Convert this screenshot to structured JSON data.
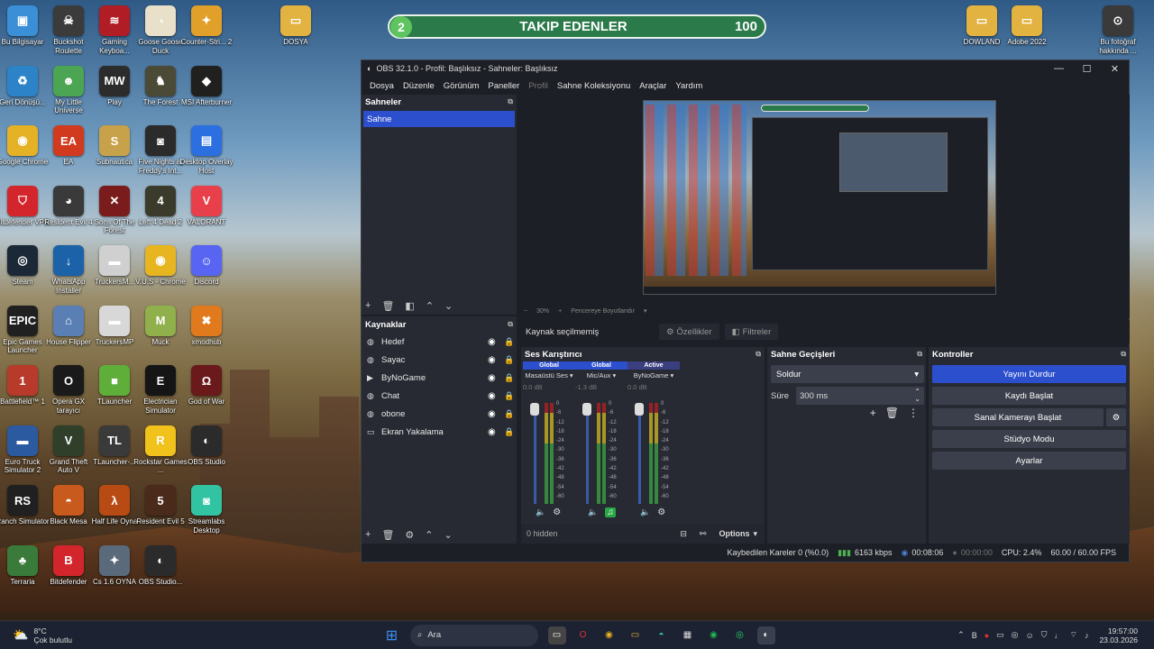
{
  "follow_bar": {
    "level": "2",
    "title": "TAKIP EDENLER",
    "count": "100"
  },
  "desktop_icons_left": [
    {
      "label": "Bu Bilgisayar",
      "color": "#3a8fd6",
      "glyph": "▣"
    },
    {
      "label": "Buckshot Roulette",
      "color": "#3b3b3b",
      "glyph": "☠"
    },
    {
      "label": "Gaming Keyboa...",
      "color": "#b01d24",
      "glyph": "≋"
    },
    {
      "label": "Goose Goose Duck",
      "color": "#e8e0c8",
      "glyph": "◔"
    },
    {
      "label": "Counter-Stri... 2",
      "color": "#e1a02a",
      "glyph": "✦"
    },
    {
      "label": "Geri Dönüşü...",
      "color": "#2d83c7",
      "glyph": "♻"
    },
    {
      "label": "My Little Universe",
      "color": "#4ca552",
      "glyph": "☻"
    },
    {
      "label": "Play",
      "color": "#2c2c2c",
      "glyph": "MW"
    },
    {
      "label": "The Forest",
      "color": "#4a4a36",
      "glyph": "♞"
    },
    {
      "label": "MSI Afterburner",
      "color": "#20201f",
      "glyph": "◆"
    },
    {
      "label": "Google Chrome",
      "color": "#e4b224",
      "glyph": "◉"
    },
    {
      "label": "EA",
      "color": "#d13a1e",
      "glyph": "EA"
    },
    {
      "label": "Subnautica",
      "color": "#c8a24a",
      "glyph": "S"
    },
    {
      "label": "Five Nights at Freddy's Int...",
      "color": "#2b2b2b",
      "glyph": "◙"
    },
    {
      "label": "Desktop Overlay Host",
      "color": "#2c6fe0",
      "glyph": "▤"
    },
    {
      "label": "Bitdefender VPN",
      "color": "#d3262c",
      "glyph": "⛉"
    },
    {
      "label": "Resident Evil 4",
      "color": "#3a3a3a",
      "glyph": "◕"
    },
    {
      "label": "Sons Of The Forest",
      "color": "#7a1c1c",
      "glyph": "✕"
    },
    {
      "label": "Left 4 Dead 2",
      "color": "#3b3b2b",
      "glyph": "4"
    },
    {
      "label": "VALORANT",
      "color": "#e8404a",
      "glyph": "V"
    },
    {
      "label": "Steam",
      "color": "#1b2838",
      "glyph": "◎"
    },
    {
      "label": "WhatsApp Installer",
      "color": "#1c62a8",
      "glyph": "↓"
    },
    {
      "label": "TruckersM...",
      "color": "#d0d0d0",
      "glyph": "▬"
    },
    {
      "label": "V.U.S - Chrome",
      "color": "#e6b520",
      "glyph": "◉"
    },
    {
      "label": "Discord",
      "color": "#5865f2",
      "glyph": "☺"
    },
    {
      "label": "Epic Games Launcher",
      "color": "#202020",
      "glyph": "EPIC"
    },
    {
      "label": "House Flipper",
      "color": "#5a7fb5",
      "glyph": "⌂"
    },
    {
      "label": "TruckersMP",
      "color": "#d8d8d8",
      "glyph": "▬"
    },
    {
      "label": "Muck",
      "color": "#8fb04a",
      "glyph": "M"
    },
    {
      "label": "xmodhub",
      "color": "#e07a1c",
      "glyph": "✖"
    },
    {
      "label": "Battlefield™ 1",
      "color": "#b83a2a",
      "glyph": "1"
    },
    {
      "label": "Opera GX tarayıcı",
      "color": "#1a1a1a",
      "glyph": "O"
    },
    {
      "label": "TLauncher",
      "color": "#5fae3a",
      "glyph": "■"
    },
    {
      "label": "Electrician Simulator",
      "color": "#151515",
      "glyph": "E"
    },
    {
      "label": "God of War",
      "color": "#6a1a1a",
      "glyph": "Ω"
    },
    {
      "label": "Euro Truck Simulator 2",
      "color": "#2b5aa0",
      "glyph": "▬"
    },
    {
      "label": "Grand Theft Auto V",
      "color": "#2f3f2a",
      "glyph": "V"
    },
    {
      "label": "TLauncher-...",
      "color": "#3a3a3a",
      "glyph": "TL"
    },
    {
      "label": "Rockstar Games ...",
      "color": "#f1c21b",
      "glyph": "R"
    },
    {
      "label": "OBS Studio",
      "color": "#2b2b2b",
      "glyph": "◐"
    },
    {
      "label": "Ranch Simulator",
      "color": "#202020",
      "glyph": "RS"
    },
    {
      "label": "Black Mesa",
      "color": "#c85a1e",
      "glyph": "◓"
    },
    {
      "label": "Half Life Oyna",
      "color": "#b84a14",
      "glyph": "λ"
    },
    {
      "label": "Resident Evil 5",
      "color": "#4a2a1a",
      "glyph": "5"
    },
    {
      "label": "Streamlabs Desktop",
      "color": "#31c3a2",
      "glyph": "◙"
    },
    {
      "label": "Terraria",
      "color": "#3a7a3a",
      "glyph": "♣"
    },
    {
      "label": "Bitdefender",
      "color": "#d3262c",
      "glyph": "B"
    },
    {
      "label": "Cs 1.6 OYNA",
      "color": "#5a6a7a",
      "glyph": "✦"
    },
    {
      "label": "OBS Studio...",
      "color": "#2b2b2b",
      "glyph": "◐"
    }
  ],
  "desktop_icons_right": [
    {
      "label": "DOSYA",
      "color": "#e3b341",
      "glyph": "▭"
    },
    {
      "label": "DOWLAND",
      "color": "#e3b341",
      "glyph": "▭"
    },
    {
      "label": "Adobe 2022",
      "color": "#e3b341",
      "glyph": "▭"
    },
    {
      "label": "Bu fotoğraf hakkında ...",
      "color": "#3a3a3a",
      "glyph": "⊙"
    }
  ],
  "obs": {
    "title": "OBS 32.1.0 - Profil: Başlıksız - Sahneler: Başlıksız",
    "menu": [
      "Dosya",
      "Düzenle",
      "Görünüm",
      "Paneller",
      "Profil",
      "Sahne Koleksiyonu",
      "Araçlar",
      "Yardım"
    ],
    "scenes_title": "Sahneler",
    "scenes": [
      "Sahne"
    ],
    "sources_title": "Kaynaklar",
    "sources": [
      {
        "name": "Hedef",
        "icon": "globe"
      },
      {
        "name": "Sayac",
        "icon": "globe"
      },
      {
        "name": "ByNoGame",
        "icon": "play"
      },
      {
        "name": "Chat",
        "icon": "globe"
      },
      {
        "name": "obone",
        "icon": "globe"
      },
      {
        "name": "Ekran Yakalama",
        "icon": "monitor"
      }
    ],
    "preview": {
      "zoom": "30%",
      "fit": "Pencereye Boyutlandır"
    },
    "props": {
      "no_source": "Kaynak seçilmemiş",
      "properties": "Özellikler",
      "filters": "Filtreler"
    },
    "mixer": {
      "title": "Ses Karıştırıcı",
      "channels": [
        {
          "tag": "Global",
          "name": "Masaüstü Ses",
          "db": "0.0 dB"
        },
        {
          "tag": "Global",
          "name": "Mic/Aux",
          "db": "-1.3 dB"
        },
        {
          "tag": "Active",
          "name": "ByNoGame",
          "db": "0.0 dB"
        }
      ],
      "scale": [
        "0",
        "-6",
        "-12",
        "-18",
        "-24",
        "-30",
        "-36",
        "-42",
        "-48",
        "-54",
        "-60"
      ],
      "hidden": "0 hidden",
      "options": "Options"
    },
    "transitions": {
      "title": "Sahne Geçişleri",
      "type": "Soldur",
      "duration_label": "Süre",
      "duration": "300 ms"
    },
    "controls": {
      "title": "Kontroller",
      "buttons": [
        "Yayını Durdur",
        "Kaydı Başlat",
        "Sanal Kamerayı Başlat",
        "Stüdyo Modu",
        "Ayarlar"
      ]
    },
    "status": {
      "dropped": "Kaybedilen Kareler 0 (%0.0)",
      "bitrate": "6163 kbps",
      "stream_time": "00:08:06",
      "rec_time": "00:00:00",
      "cpu": "CPU: 2.4%",
      "fps": "60.00 / 60.00 FPS"
    },
    "accent": "#2c4fce"
  },
  "taskbar": {
    "weather_temp": "8°C",
    "weather_desc": "Çok bulutlu",
    "search_placeholder": "Ara",
    "time": "19:57:00",
    "date": "23.03.2026"
  }
}
